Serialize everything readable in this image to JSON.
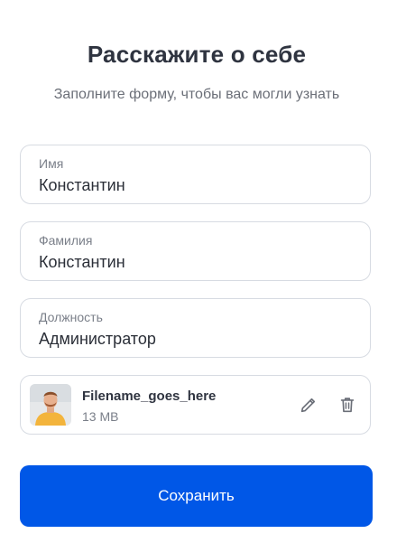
{
  "header": {
    "title": "Расскажите о себе",
    "subtitle": "Заполните форму, чтобы вас могли узнать"
  },
  "form": {
    "first_name": {
      "label": "Имя",
      "value": "Константин"
    },
    "last_name": {
      "label": "Фамилия",
      "value": "Константин"
    },
    "position": {
      "label": "Должность",
      "value": "Администратор"
    }
  },
  "file": {
    "name": "Filename_goes_here",
    "size": "13 MB",
    "thumbnail_icon": "user-photo",
    "actions": [
      "pencil-icon",
      "trash-icon"
    ]
  },
  "save_label": "Сохранить",
  "colors": {
    "primary": "#0057e7",
    "border": "#d7dbe2",
    "title": "#2f3440",
    "muted": "#7a7f89"
  }
}
